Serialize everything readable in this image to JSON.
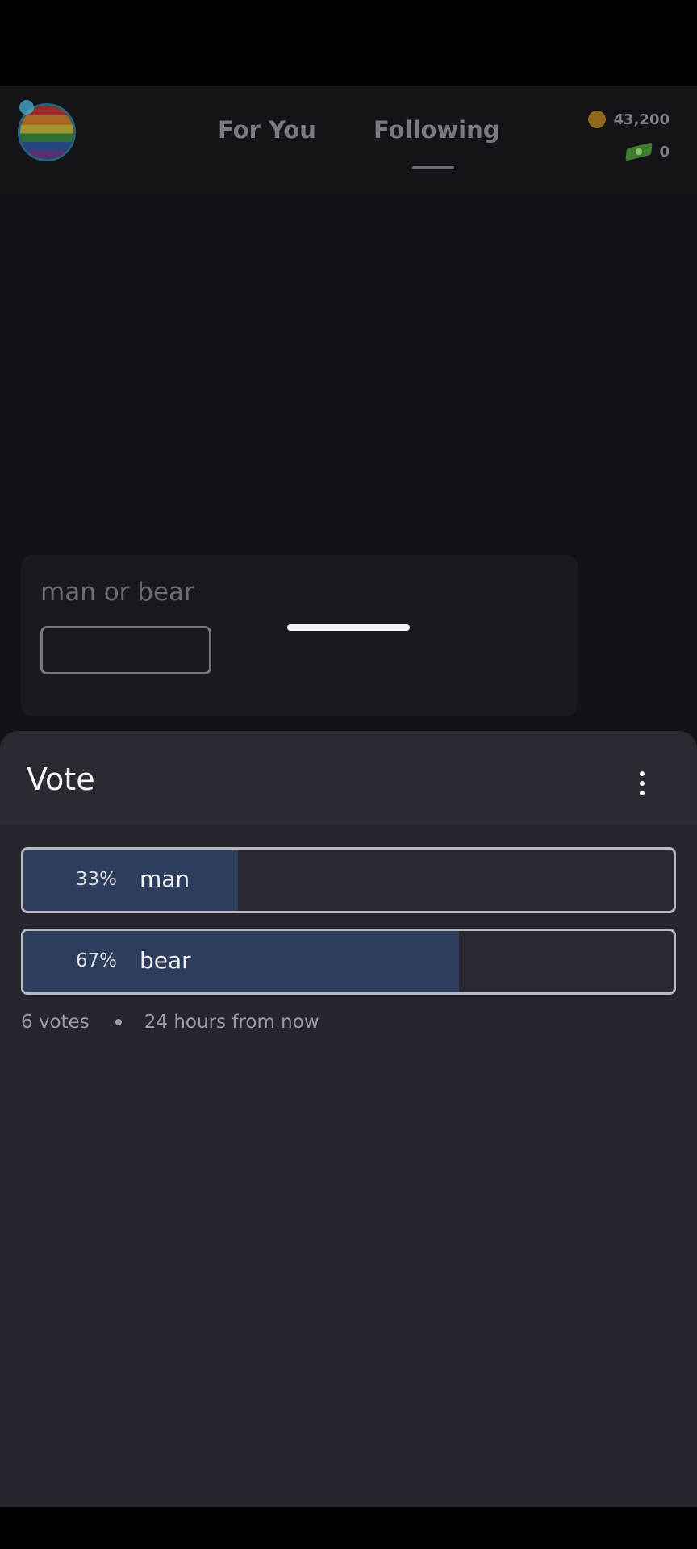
{
  "header": {
    "tabs": [
      {
        "label": "For You",
        "active": false
      },
      {
        "label": "Following",
        "active": true
      }
    ],
    "balances": {
      "coins": "43,200",
      "gems": "0"
    }
  },
  "post": {
    "title": "man or bear"
  },
  "vote_sheet": {
    "title": "Vote",
    "options": [
      {
        "percent_text": "33%",
        "label": "man",
        "percent": 33
      },
      {
        "percent_text": "67%",
        "label": "bear",
        "percent": 67
      }
    ],
    "votes_text": "6 votes",
    "time_text": "24 hours from now"
  },
  "colors": {
    "sheet_bg": "#27262f",
    "option_fill": "#2c3d5d",
    "option_border": "#b9b8c0"
  },
  "icons": {
    "avatar": "avatar",
    "coin": "coin-icon",
    "gem": "gem-icon",
    "more": "more-vertical-icon"
  }
}
